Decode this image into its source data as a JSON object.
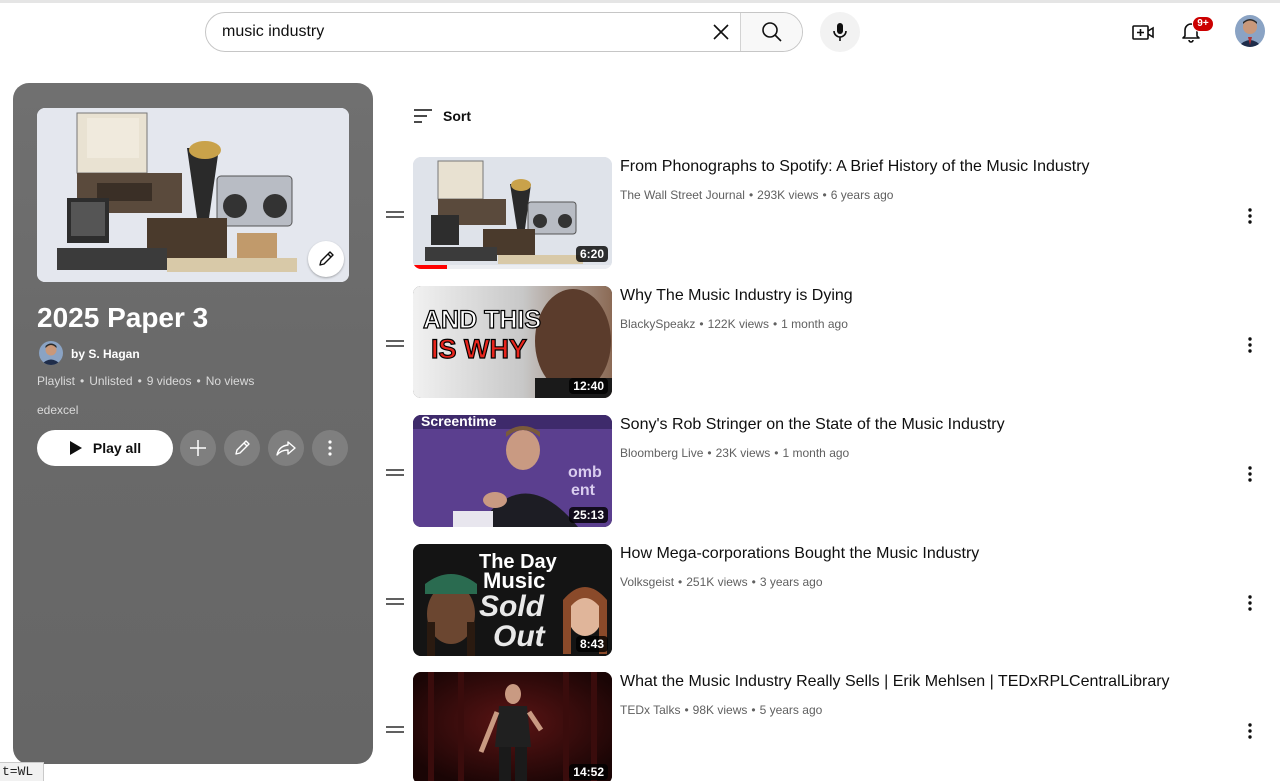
{
  "search": {
    "value": "music industry"
  },
  "header": {
    "notification_badge": "9+"
  },
  "playlist": {
    "title": "2025 Paper 3",
    "owner": "by S. Hagan",
    "meta": [
      "Playlist",
      "Unlisted",
      "9 videos",
      "No views"
    ],
    "description": "edexcel",
    "play_all_label": "Play all"
  },
  "sort_label": "Sort",
  "videos": [
    {
      "title": "From Phonographs to Spotify: A Brief History of the Music Industry",
      "channel": "The Wall Street Journal",
      "views": "293K views",
      "age": "6 years ago",
      "duration": "6:20",
      "watched": 0.17
    },
    {
      "title": "Why The Music Industry is Dying",
      "channel": "BlackySpeakz",
      "views": "122K views",
      "age": "1 month ago",
      "duration": "12:40",
      "thumb_text": [
        "AND THIS",
        "IS WHY"
      ]
    },
    {
      "title": "Sony's Rob Stringer on the State of the Music Industry",
      "channel": "Bloomberg Live",
      "views": "23K views",
      "age": "1 month ago",
      "duration": "25:13",
      "thumb_text": [
        "Screentime",
        "omb",
        "ent"
      ]
    },
    {
      "title": "How Mega-corporations Bought the Music Industry",
      "channel": "Volksgeist",
      "views": "251K views",
      "age": "3 years ago",
      "duration": "8:43",
      "thumb_text": [
        "The Day",
        "Music",
        "Sold",
        "Out"
      ]
    },
    {
      "title": "What the Music Industry Really Sells | Erik Mehlsen | TEDxRPLCentralLibrary",
      "channel": "TEDx Talks",
      "views": "98K views",
      "age": "5 years ago",
      "duration": "14:52"
    }
  ],
  "status_url": "t=WL",
  "colors": {
    "accent_red": "#ff0000",
    "badge_red": "#cc0000",
    "panel_gray": "#6a6a6a"
  }
}
